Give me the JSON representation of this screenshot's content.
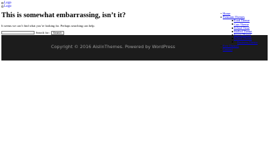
{
  "header": {
    "logos": [
      {
        "alt": "Logo"
      },
      {
        "alt": "Logo"
      }
    ]
  },
  "content": {
    "title": "This is somewhat embarrassing, isn’t it?",
    "message": "It seems we can’t find what you’re looking for. Perhaps searching can help.",
    "search": {
      "label": "Search for:",
      "button": "Search",
      "value": ""
    }
  },
  "nav": {
    "home": "Home",
    "premium": "Premium Themes",
    "sub": [
      "Food Theme",
      "Cars Theme",
      "School Time",
      "Skilled Theme",
      "Sports Theme",
      "School Theme",
      "Business Theme"
    ],
    "after": [
      "Free Themes",
      "Contact"
    ]
  },
  "footer": {
    "copyright": "Copyright © 2016 AislinThemes. Powered by WordPress"
  }
}
